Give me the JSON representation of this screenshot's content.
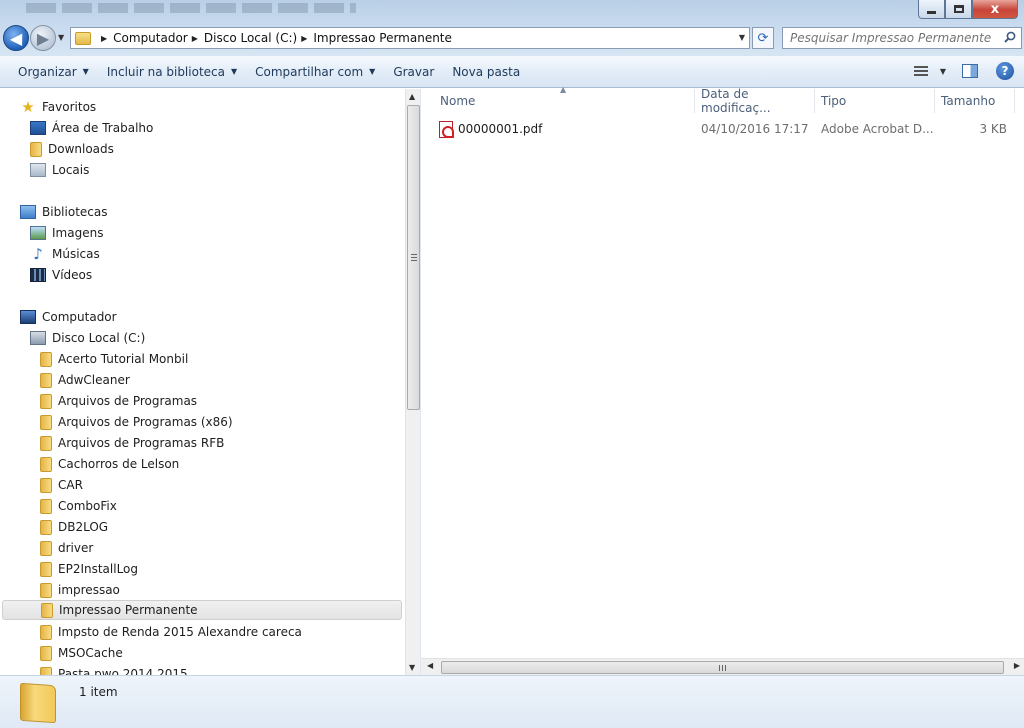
{
  "window": {
    "min_label": "_",
    "max_label": "",
    "close_label": "x"
  },
  "nav": {
    "back_label": "◀",
    "forward_label": "▶"
  },
  "address": {
    "crumbs": [
      "Computador",
      "Disco Local (C:)",
      "Impressao Permanente"
    ]
  },
  "search": {
    "placeholder": "Pesquisar Impressao Permanente"
  },
  "toolbar": {
    "organize": "Organizar",
    "include_library": "Incluir na biblioteca",
    "share": "Compartilhar com",
    "burn": "Gravar",
    "new_folder": "Nova pasta",
    "help": "?"
  },
  "sidebar": {
    "favorites": {
      "label": "Favoritos",
      "items": [
        "Área de Trabalho",
        "Downloads",
        "Locais"
      ]
    },
    "libraries": {
      "label": "Bibliotecas",
      "items": [
        "Imagens",
        "Músicas",
        "Vídeos"
      ]
    },
    "computer": {
      "label": "Computador",
      "drive": "Disco Local (C:)",
      "folders": [
        "Acerto Tutorial Monbil",
        "AdwCleaner",
        "Arquivos de Programas",
        "Arquivos de Programas (x86)",
        "Arquivos de Programas RFB",
        "Cachorros de Lelson",
        "CAR",
        "ComboFix",
        "DB2LOG",
        "driver",
        "EP2InstallLog",
        "impressao",
        "Impressao Permanente",
        "Impsto de Renda 2015 Alexandre careca",
        "MSOCache",
        "Pasta pwo 2014 2015"
      ],
      "selected": "Impressao Permanente"
    }
  },
  "filelist": {
    "columns": [
      "Nome",
      "Data de modificaç...",
      "Tipo",
      "Tamanho"
    ],
    "rows": [
      {
        "name": "00000001.pdf",
        "date": "04/10/2016 17:17",
        "type": "Adobe Acrobat D...",
        "size": "3 KB"
      }
    ]
  },
  "status": {
    "count": "1 item"
  },
  "colors": {
    "accent": "#1e395b",
    "titlebar": "#c8daee",
    "selection": "#e3e3e3"
  }
}
